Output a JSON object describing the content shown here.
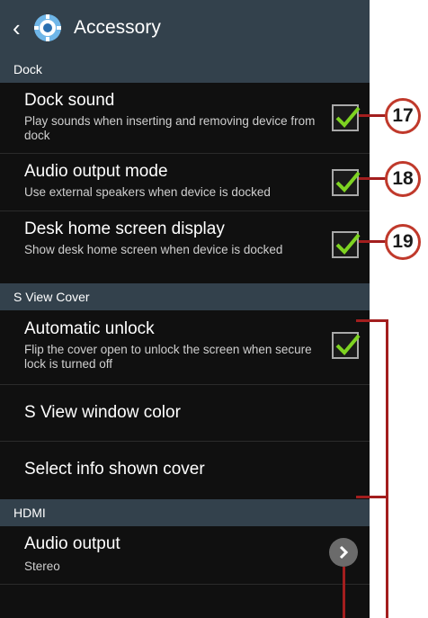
{
  "header": {
    "title": "Accessory",
    "back_icon": "chevron-left-icon",
    "app_icon": "gear-icon"
  },
  "sections": {
    "dock": "Dock",
    "sview": "S View Cover",
    "hdmi": "HDMI"
  },
  "rows": {
    "dock_sound": {
      "title": "Dock sound",
      "subtitle": "Play sounds when inserting and removing device from dock",
      "checked": true
    },
    "audio_output_mode": {
      "title": "Audio output mode",
      "subtitle": "Use external speakers when device is docked",
      "checked": true
    },
    "desk_home": {
      "title": "Desk home screen display",
      "subtitle": "Show desk home screen when device is docked",
      "checked": true
    },
    "auto_unlock": {
      "title": "Automatic unlock",
      "subtitle": "Flip the cover open to unlock the screen when secure lock is turned off",
      "checked": true
    },
    "sview_color": {
      "title": "S View window color"
    },
    "select_info": {
      "title": "Select info shown cover"
    },
    "audio_output": {
      "title": "Audio output",
      "subtitle": "Stereo"
    }
  },
  "callouts": [
    "17",
    "18",
    "19"
  ],
  "colors": {
    "accent_bar": "#33414c",
    "check": "#7ed321",
    "callout": "#c0392b"
  }
}
